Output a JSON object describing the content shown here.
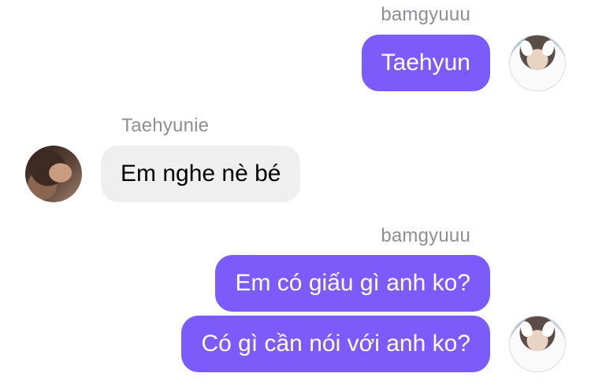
{
  "messages": [
    {
      "sender": "bamgyuuu",
      "direction": "outgoing",
      "text": "Taehyun",
      "avatar": "bamgyuuu-avatar"
    },
    {
      "sender": "Taehyunie",
      "direction": "incoming",
      "text": "Em nghe nè bé",
      "avatar": "taehyunie-avatar"
    },
    {
      "sender": "bamgyuuu",
      "direction": "outgoing",
      "text": "Em có giấu gì anh ko?"
    },
    {
      "sender": "bamgyuuu",
      "direction": "outgoing",
      "text": "Có gì cần nói với anh ko?",
      "avatar": "bamgyuuu-avatar"
    }
  ],
  "colors": {
    "outgoing_bubble": "#7b5cfb",
    "incoming_bubble": "#efefef",
    "sender_name": "#8e8e93"
  }
}
